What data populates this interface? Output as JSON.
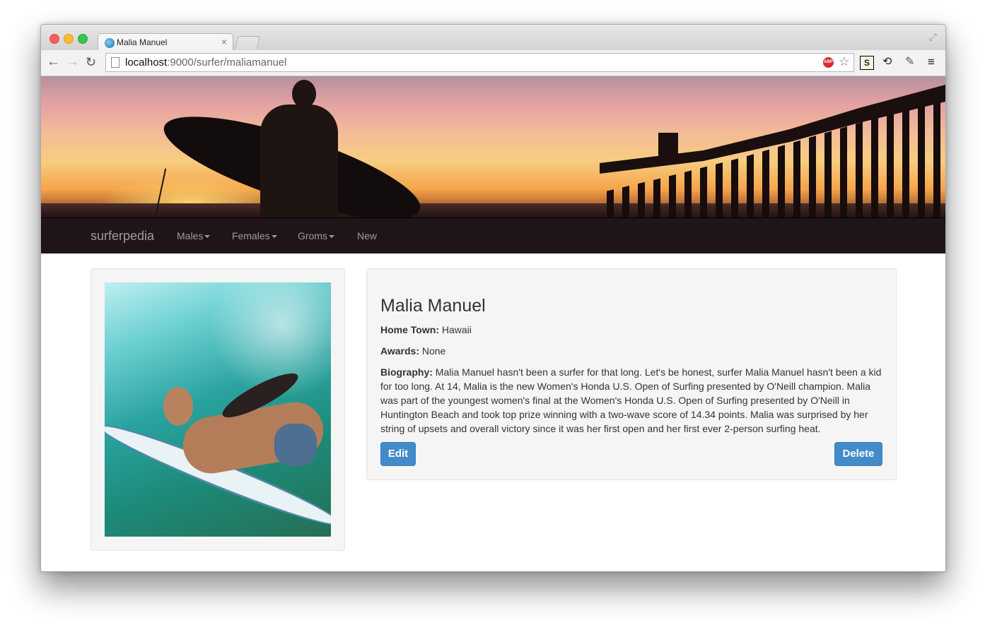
{
  "browser": {
    "tab_title": "Malia Manuel",
    "tab_close": "×",
    "url_host": "localhost",
    "url_path": ":9000/surfer/maliamanuel",
    "adblock_label": "ABP"
  },
  "navbar": {
    "brand": "surferpedia",
    "items": [
      {
        "label": "Males",
        "dropdown": true
      },
      {
        "label": "Females",
        "dropdown": true
      },
      {
        "label": "Groms",
        "dropdown": true
      },
      {
        "label": "New",
        "dropdown": false
      }
    ]
  },
  "surfer": {
    "name": "Malia Manuel",
    "hometown_label": "Home Town:",
    "hometown": "Hawaii",
    "awards_label": "Awards:",
    "awards": "None",
    "bio_label": "Biography:",
    "bio": "Malia Manuel hasn't been a surfer for that long. Let's be honest, surfer Malia Manuel hasn't been a kid for too long. At 14, Malia is the new Women's Honda U.S. Open of Surfing presented by O'Neill champion. Malia was part of the youngest women's final at the Women's Honda U.S. Open of Surfing presented by O'Neill in Huntington Beach and took top prize winning with a two-wave score of 14.34 points. Malia was surprised by her string of upsets and overall victory since it was her first open and her first ever 2-person surfing heat."
  },
  "actions": {
    "edit": "Edit",
    "delete": "Delete"
  },
  "colors": {
    "primary_button": "#428bca",
    "navbar_bg": "#1f1417",
    "well_bg": "#f5f5f5"
  }
}
